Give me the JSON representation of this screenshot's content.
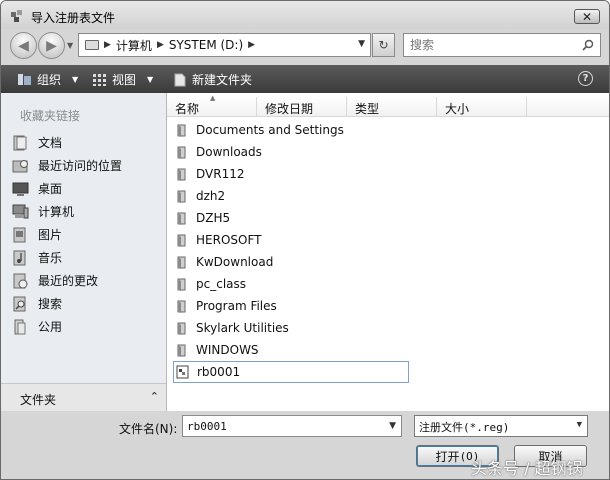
{
  "window": {
    "title": "导入注册表文件",
    "close_label": "✕"
  },
  "address": {
    "segments": [
      "计算机",
      "SYSTEM (D:)"
    ],
    "search_placeholder": "搜索"
  },
  "toolbar": {
    "organize": "组织",
    "views": "视图",
    "new_folder": "新建文件夹",
    "help": "?"
  },
  "navpane": {
    "favorites_header": "收藏夹链接",
    "items": [
      {
        "label": "文档",
        "icon": "documents-icon"
      },
      {
        "label": "最近访问的位置",
        "icon": "recent-places-icon"
      },
      {
        "label": "桌面",
        "icon": "desktop-icon"
      },
      {
        "label": "计算机",
        "icon": "computer-icon"
      },
      {
        "label": "图片",
        "icon": "pictures-icon"
      },
      {
        "label": "音乐",
        "icon": "music-icon"
      },
      {
        "label": "最近的更改",
        "icon": "recent-changes-icon"
      },
      {
        "label": "搜索",
        "icon": "search-folder-icon"
      },
      {
        "label": "公用",
        "icon": "public-icon"
      }
    ],
    "folders_label": "文件夹"
  },
  "columns": [
    "名称",
    "修改日期",
    "类型",
    "大小"
  ],
  "files": [
    {
      "name": "Documents and Settings",
      "kind": "folder"
    },
    {
      "name": "Downloads",
      "kind": "folder"
    },
    {
      "name": "DVR112",
      "kind": "folder"
    },
    {
      "name": "dzh2",
      "kind": "folder"
    },
    {
      "name": "DZH5",
      "kind": "folder"
    },
    {
      "name": "HEROSOFT",
      "kind": "folder"
    },
    {
      "name": "KwDownload",
      "kind": "folder"
    },
    {
      "name": "pc_class",
      "kind": "folder"
    },
    {
      "name": "Program Files",
      "kind": "folder"
    },
    {
      "name": "Skylark Utilities",
      "kind": "folder"
    },
    {
      "name": "WINDOWS",
      "kind": "folder"
    },
    {
      "name": "rb0001",
      "kind": "reg-file"
    }
  ],
  "bottom": {
    "filename_label": "文件名(N):",
    "filename_value": "rb0001",
    "filetype_value": "注册文件(*.reg)",
    "open_label": "打开",
    "open_accel": "(O)",
    "cancel_label": "取消"
  },
  "watermark": "头条号 / 超钢锅"
}
